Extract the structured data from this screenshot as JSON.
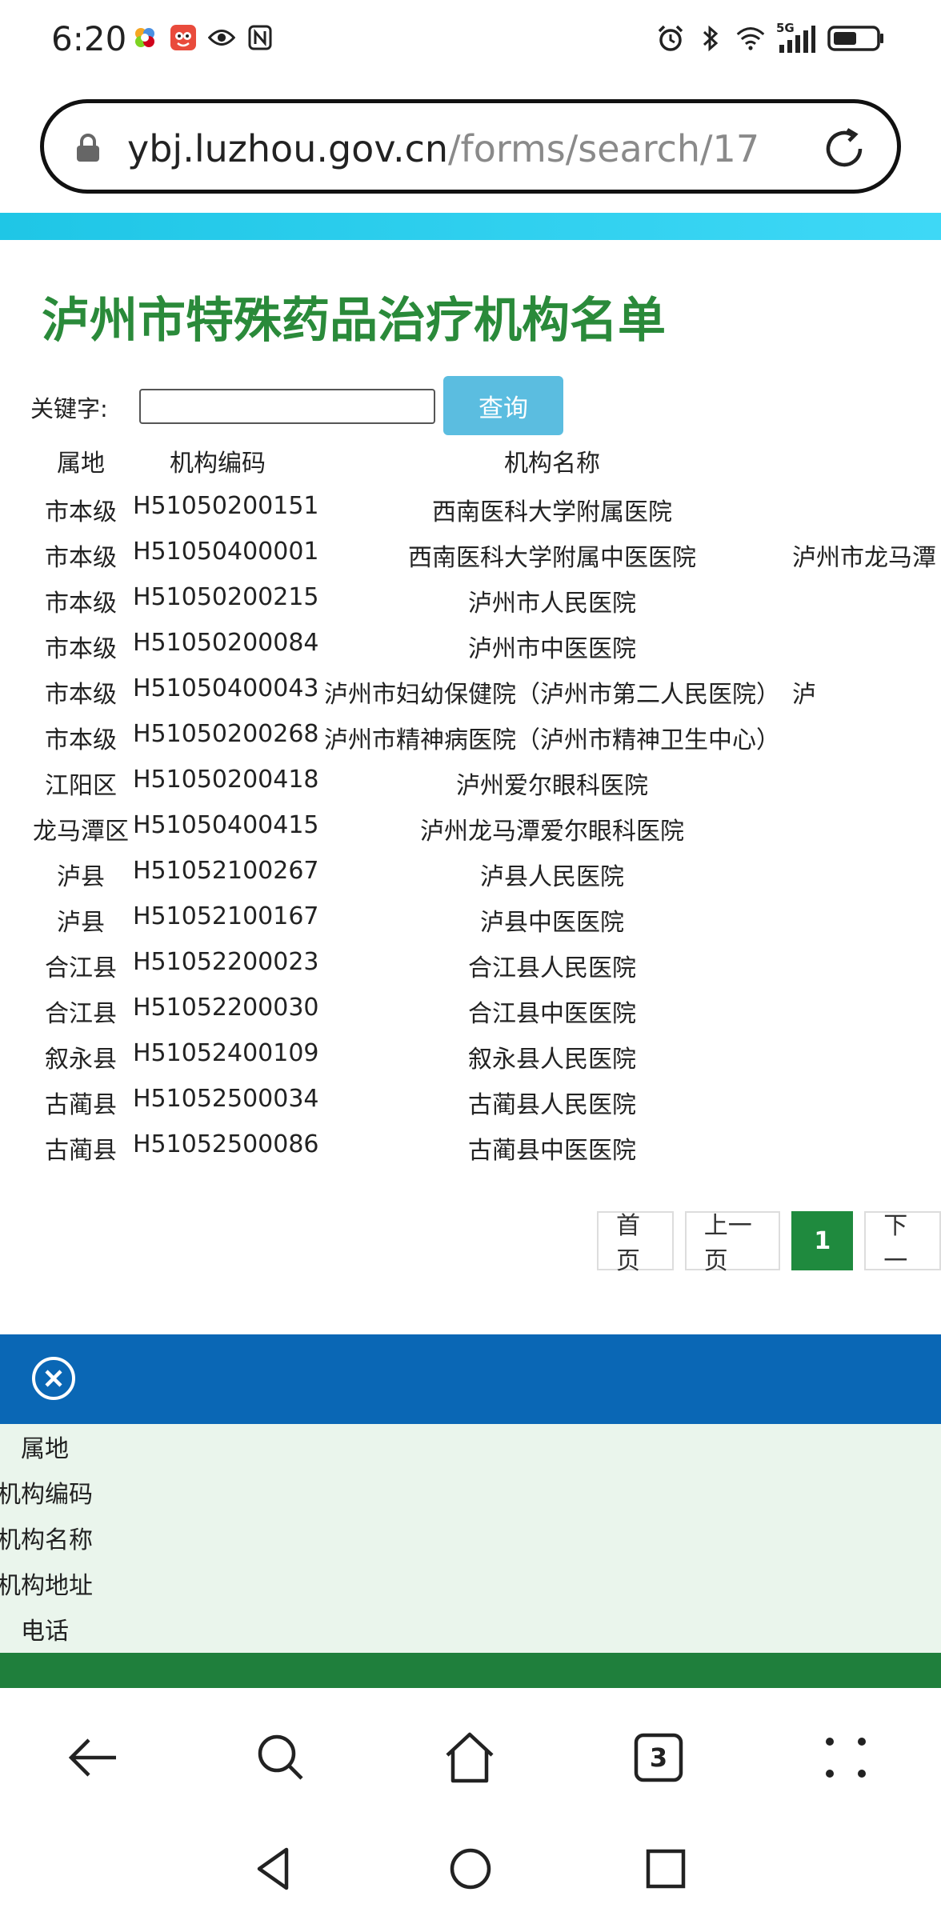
{
  "status": {
    "time": "6:20",
    "net_type": "5G"
  },
  "browser": {
    "url_host": "ybj.luzhou.gov.cn",
    "url_path": "/forms/search/17",
    "tab_count": "3"
  },
  "page": {
    "title": "泸州市特殊药品治疗机构名单",
    "keyword_label": "关键字:",
    "keyword_value": "",
    "search_button": "查询"
  },
  "table": {
    "headers": {
      "area": "属地",
      "code": "机构编码",
      "name": "机构名称"
    },
    "rows": [
      {
        "area": "市本级",
        "code": "H51050200151",
        "name": "西南医科大学附属医院",
        "extra": ""
      },
      {
        "area": "市本级",
        "code": "H51050400001",
        "name": "西南医科大学附属中医医院",
        "extra": "泸州市龙马潭"
      },
      {
        "area": "市本级",
        "code": "H51050200215",
        "name": "泸州市人民医院",
        "extra": ""
      },
      {
        "area": "市本级",
        "code": "H51050200084",
        "name": "泸州市中医医院",
        "extra": ""
      },
      {
        "area": "市本级",
        "code": "H51050400043",
        "name": "泸州市妇幼保健院（泸州市第二人民医院）",
        "extra": "泸"
      },
      {
        "area": "市本级",
        "code": "H51050200268",
        "name": "泸州市精神病医院（泸州市精神卫生中心）",
        "extra": ""
      },
      {
        "area": "江阳区",
        "code": "H51050200418",
        "name": "泸州爱尔眼科医院",
        "extra": ""
      },
      {
        "area": "龙马潭区",
        "code": "H51050400415",
        "name": "泸州龙马潭爱尔眼科医院",
        "extra": ""
      },
      {
        "area": "泸县",
        "code": "H51052100267",
        "name": "泸县人民医院",
        "extra": ""
      },
      {
        "area": "泸县",
        "code": "H51052100167",
        "name": "泸县中医医院",
        "extra": ""
      },
      {
        "area": "合江县",
        "code": "H51052200023",
        "name": "合江县人民医院",
        "extra": ""
      },
      {
        "area": "合江县",
        "code": "H51052200030",
        "name": "合江县中医医院",
        "extra": ""
      },
      {
        "area": "叙永县",
        "code": "H51052400109",
        "name": "叙永县人民医院",
        "extra": ""
      },
      {
        "area": "古蔺县",
        "code": "H51052500034",
        "name": "古蔺县人民医院",
        "extra": ""
      },
      {
        "area": "古蔺县",
        "code": "H51052500086",
        "name": "古蔺县中医医院",
        "extra": ""
      }
    ]
  },
  "pager": {
    "first": "首页",
    "prev": "上一页",
    "current": "1",
    "next": "下一"
  },
  "panel": {
    "fields": [
      "属地",
      "机构编码",
      "机构名称",
      "机构地址",
      "电话"
    ]
  },
  "colors": {
    "title_green": "#2a8a3a",
    "button_blue": "#5bbde0",
    "panel_blue": "#0a67b5",
    "panel_green": "#1f7f3c",
    "active_page": "#1f8a3e"
  }
}
